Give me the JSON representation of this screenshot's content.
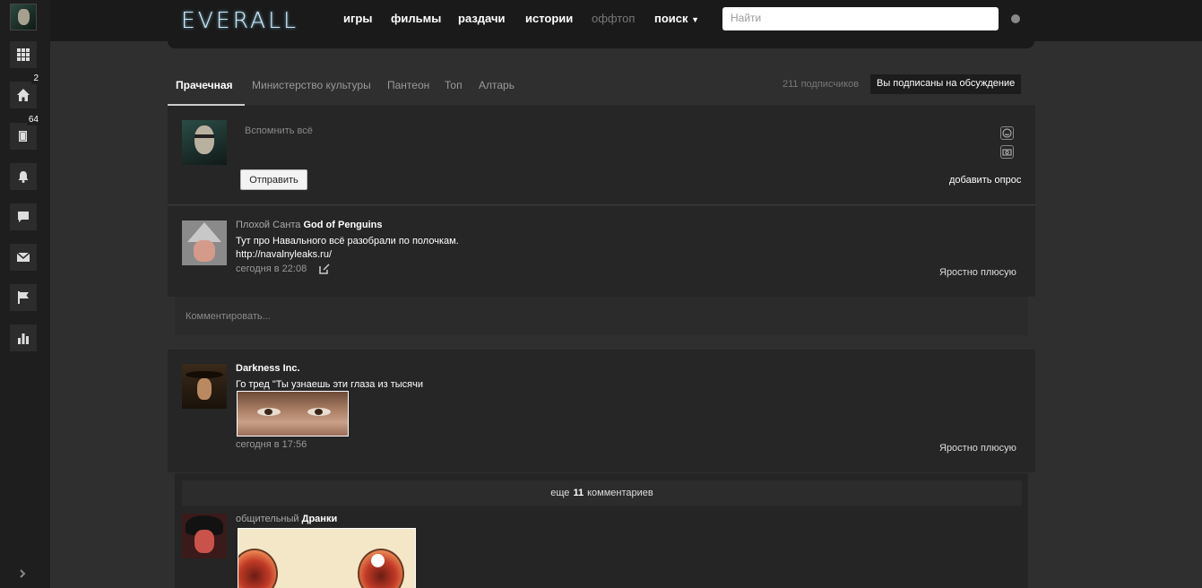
{
  "sidebar": {
    "badges": {
      "home": "2",
      "posts": "64"
    }
  },
  "topbar": {
    "logo": "EVERALL",
    "nav": [
      "игры",
      "фильмы",
      "раздачи",
      "истории",
      "оффтоп",
      "поиск"
    ],
    "search_placeholder": "Найти"
  },
  "tabs": {
    "items": [
      "Прачечная",
      "Министерство культуры",
      "Пантеон",
      "Топ",
      "Алтарь"
    ],
    "subscribers": "211 подписчиков",
    "subscribed_label": "Вы подписаны на обсуждение"
  },
  "composer": {
    "placeholder": "Вспомнить всё",
    "send_label": "Отправить",
    "poll_label": "добавить опрос"
  },
  "posts": [
    {
      "author_prefix": "Плохой Санта",
      "author": "God of Penguins",
      "text": "Тут про Навального всё разобрали по полочкам.",
      "link": "http://navalnyleaks.ru/",
      "time": "сегодня в 22:08",
      "like": "Яростно плюсую"
    },
    {
      "author": "Darkness Inc.",
      "text": "Го тред \"Ты узнаешь эти глаза из тысячи",
      "time": "сегодня в 17:56",
      "like": "Яростно плюсую"
    }
  ],
  "comment_placeholder": "Комментировать...",
  "more_comments": {
    "prefix": "еще",
    "count": "11",
    "suffix": "комментариев"
  },
  "reply": {
    "author_prefix": "общительный",
    "author": "Дранки"
  }
}
